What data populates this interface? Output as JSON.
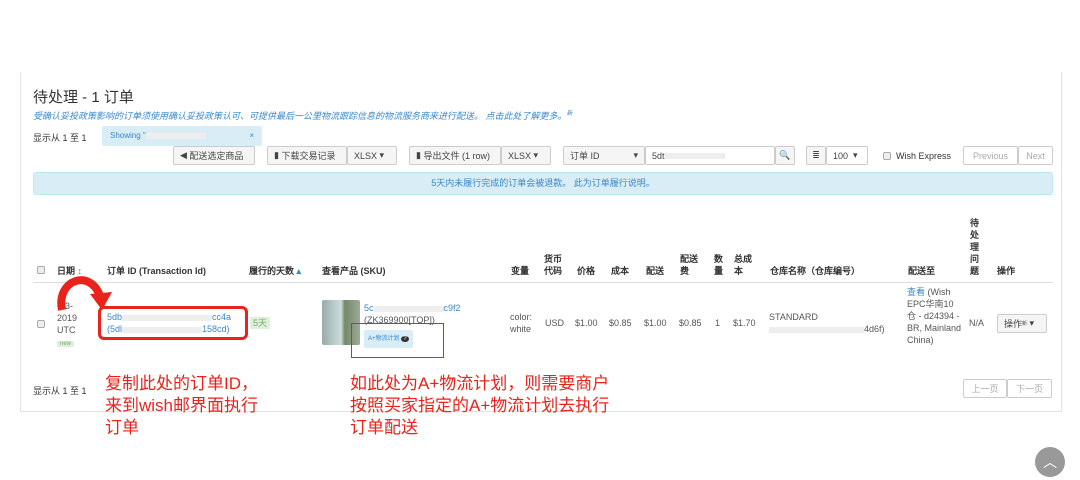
{
  "header": {
    "title": "待处理 - 1 订单",
    "notice": "受确认妥投政策影响的订单须使用确认妥投政策认可、可提供最后一公里物流跟踪信息的物流服务商来进行配送。 点击此处了解更多。",
    "notice_badge": "新"
  },
  "toolbar": {
    "showing_range": "显示从 1 至 1",
    "filter_chip": "Showing \"",
    "filter_close": "×",
    "ship_selected": "配送选定商品",
    "download_records": "下载交易记录",
    "download_format": "XLSX",
    "export_file": "导出文件 (1 row)",
    "export_format": "XLSX",
    "search_field": "订单 ID",
    "search_value": "5dt",
    "page_size": "100",
    "wish_express": "Wish Express",
    "previous": "Previous",
    "next": "Next"
  },
  "alert": {
    "text": "5天内未履行完成的订单会被退款。",
    "link": "此为订单履行说明。"
  },
  "columns": [
    "日期",
    "订单 ID (Transaction Id)",
    "履行的天数",
    "查看产品 (SKU)",
    "变量",
    "货币代码",
    "价格",
    "成本",
    "配送",
    "配送费",
    "数量",
    "总成本",
    "仓库名称（仓库编号）",
    "配送至",
    "待处理问题",
    "操作"
  ],
  "row": {
    "date": "-03-",
    "year": "2019",
    "tz": "UTC",
    "new_badge": "new",
    "order_id": "5db",
    "order_id_end": "cc4a",
    "txn_id": "(5dl",
    "txn_id_end": "158cd)",
    "days": "5天",
    "product_id": "5c",
    "product_id_end": "c9f2",
    "sku": "(ZK369900[TOP])",
    "aplus_badge": "A+物流计划",
    "variant": "color: white",
    "currency": "USD",
    "price": "$1.00",
    "cost": "$0.85",
    "shipping": "$1.00",
    "shipping_fee": "$0.85",
    "quantity": "1",
    "total_cost": "$1.70",
    "warehouse": "STANDARD",
    "warehouse_id_end": "4d6f)",
    "ship_to_link": "查看",
    "ship_to": "(Wish EPC华南10仓 - d24394 - BR, Mainland China)",
    "pending_issue": "N/A",
    "action": "操作",
    "action_badge": "新"
  },
  "footer": {
    "showing_range": "显示从 1 至 1",
    "prev": "上一页",
    "next": "下一页"
  },
  "annotations": {
    "left": "复制此处的订单ID，来到wish邮界面执行订单",
    "right": "如此处为A+物流计划，则需要商户按照买家指定的A+物流计划去执行订单配送"
  }
}
